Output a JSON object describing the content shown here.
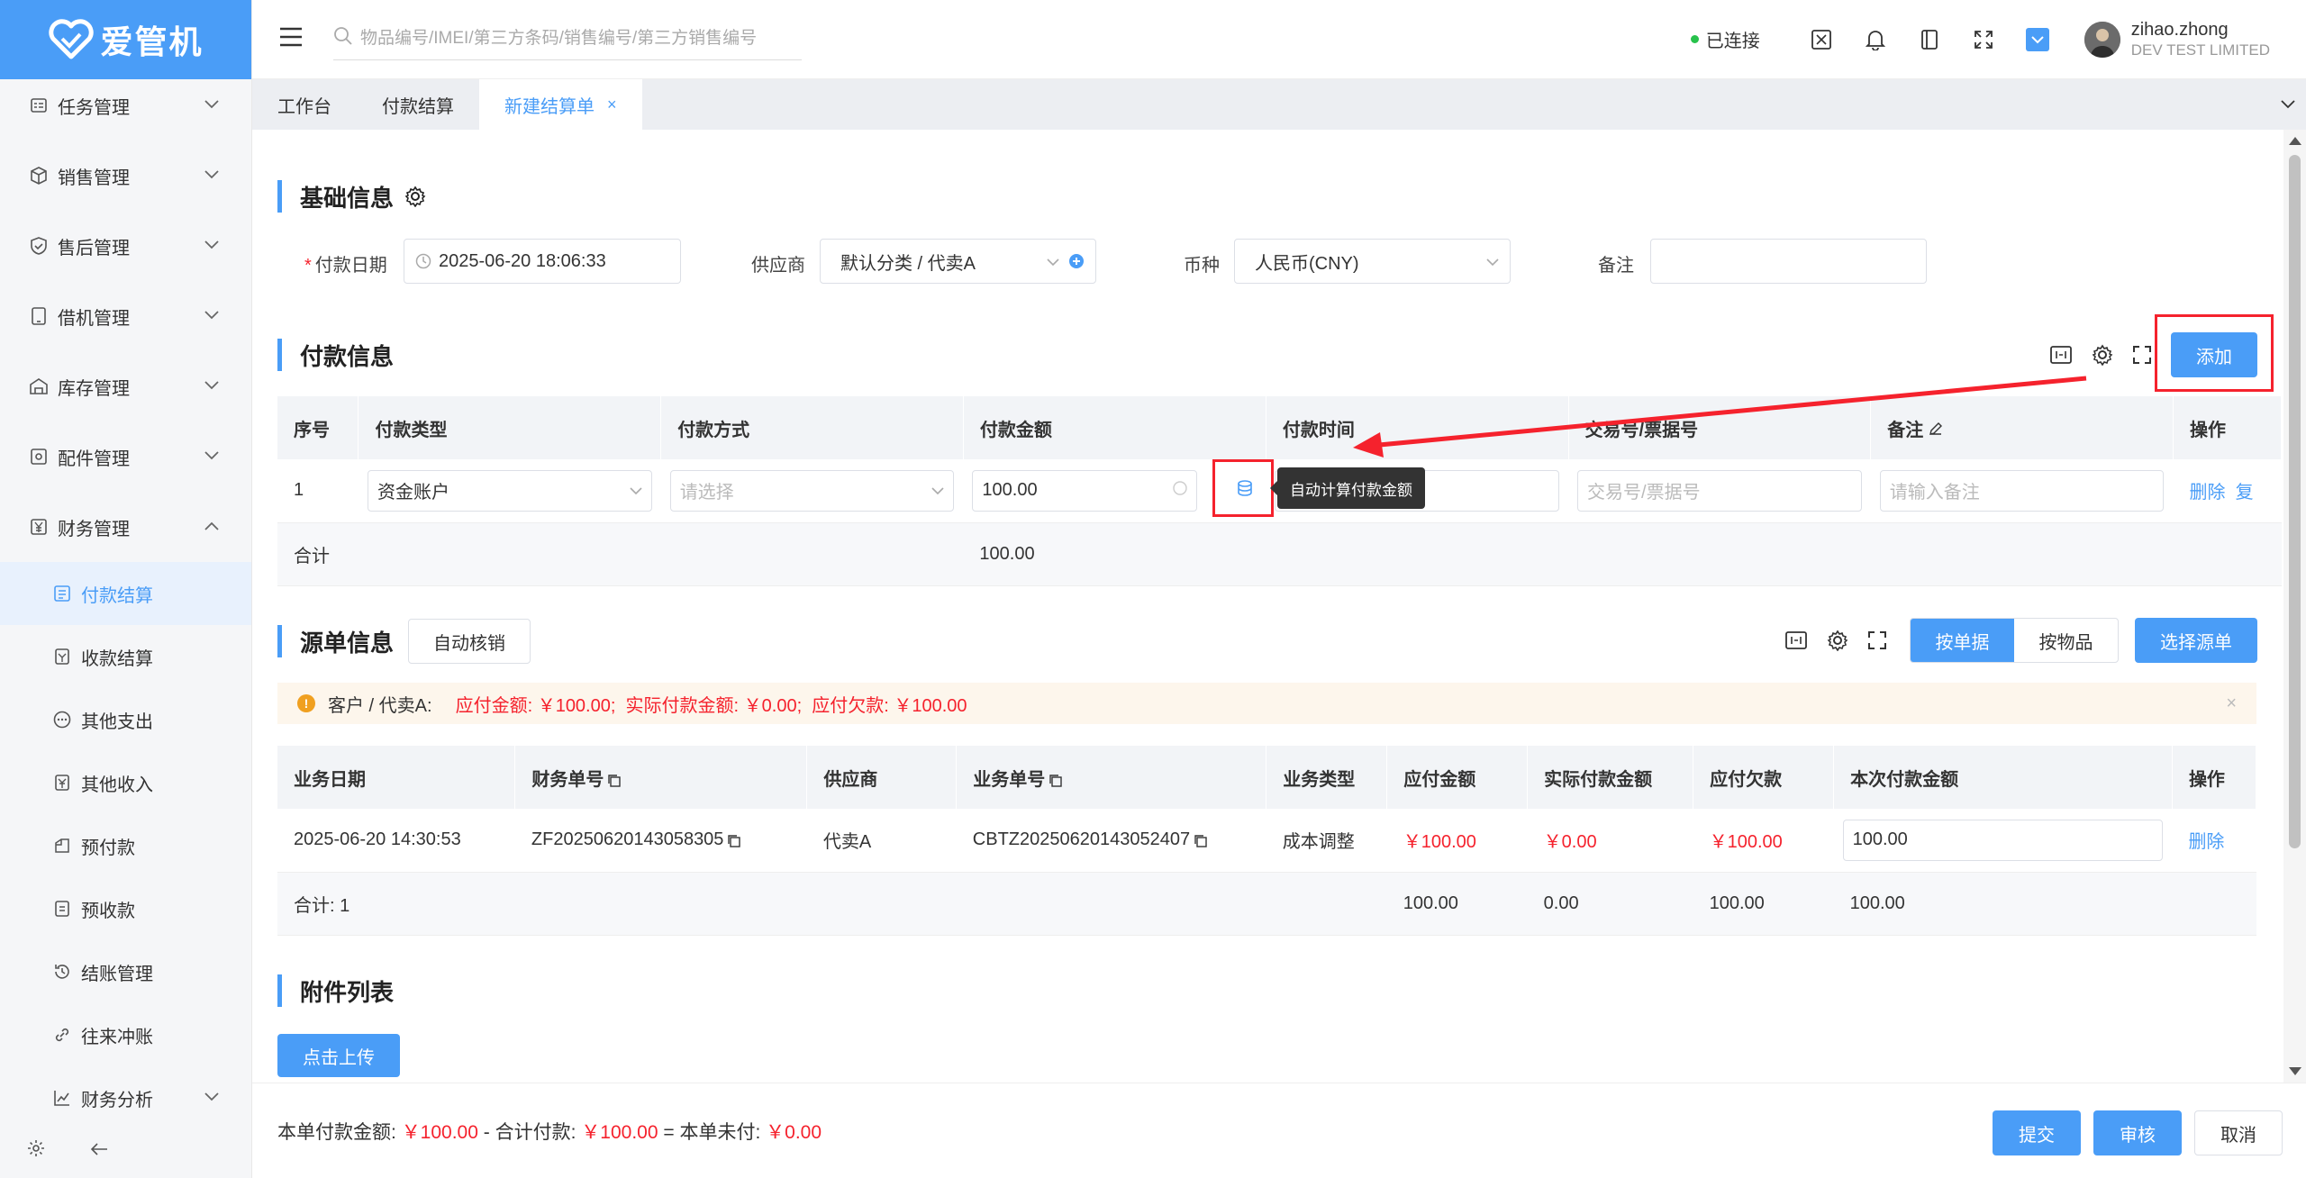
{
  "app": {
    "logo_text": "爱管机"
  },
  "sidebar": {
    "items": [
      {
        "label": "任务管理",
        "icon": "task-icon"
      },
      {
        "label": "销售管理",
        "icon": "box-icon"
      },
      {
        "label": "售后管理",
        "icon": "shield-icon"
      },
      {
        "label": "借机管理",
        "icon": "phone-icon"
      },
      {
        "label": "库存管理",
        "icon": "warehouse-icon"
      },
      {
        "label": "配件管理",
        "icon": "parts-icon"
      },
      {
        "label": "财务管理",
        "icon": "yen-icon"
      }
    ],
    "finance_sub": [
      {
        "label": "付款结算",
        "active": true
      },
      {
        "label": "收款结算"
      },
      {
        "label": "其他支出"
      },
      {
        "label": "其他收入"
      },
      {
        "label": "预付款"
      },
      {
        "label": "预收款"
      },
      {
        "label": "结账管理"
      },
      {
        "label": "往来冲账"
      }
    ],
    "analysis": {
      "label": "财务分析"
    }
  },
  "topbar": {
    "search_placeholder": "物品编号/IMEI/第三方条码/销售编号/第三方销售编号",
    "status": "已连接",
    "user_name": "zihao.zhong",
    "user_company": "DEV TEST LIMITED"
  },
  "tabs": [
    {
      "label": "工作台"
    },
    {
      "label": "付款结算"
    },
    {
      "label": "新建结算单",
      "active": true
    }
  ],
  "basic": {
    "title": "基础信息",
    "pay_date_label": "付款日期",
    "pay_date_value": "2025-06-20 18:06:33",
    "supplier_label": "供应商",
    "supplier_value": "默认分类 / 代卖A",
    "currency_label": "币种",
    "currency_value": "人民币(CNY)",
    "remark_label": "备注"
  },
  "payment": {
    "title": "付款信息",
    "add_button": "添加",
    "headers": [
      "序号",
      "付款类型",
      "付款方式",
      "付款金额",
      "付款时间",
      "交易号/票据号",
      "备注",
      "操作"
    ],
    "row": {
      "index": "1",
      "type": "资金账户",
      "method_placeholder": "请选择",
      "amount": "100.00",
      "trade_placeholder": "交易号/票据号",
      "remark_placeholder": "请输入备注",
      "delete": "删除",
      "copy": "复"
    },
    "tooltip": "自动计算付款金额",
    "sum_label": "合计",
    "sum_amount": "100.00"
  },
  "source": {
    "title": "源单信息",
    "auto_button": "自动核销",
    "seg_by_order": "按单据",
    "seg_by_item": "按物品",
    "select_button": "选择源单",
    "alert": {
      "customer": "客户 / 代卖A:",
      "text": "应付金额: ￥100.00;  实际付款金额: ￥0.00;  应付欠款: ￥100.00"
    },
    "headers": [
      "业务日期",
      "财务单号",
      "供应商",
      "业务单号",
      "业务类型",
      "应付金额",
      "实际付款金额",
      "应付欠款",
      "本次付款金额",
      "操作"
    ],
    "row": {
      "date": "2025-06-20 14:30:53",
      "fin_no": "ZF20250620143058305",
      "supplier": "代卖A",
      "biz_no": "CBTZ20250620143052407",
      "biz_type": "成本调整",
      "payable": "￥100.00",
      "paid": "￥0.00",
      "owed": "￥100.00",
      "this_pay": "100.00",
      "delete": "删除"
    },
    "sum": {
      "label": "合计: 1",
      "payable": "100.00",
      "paid": "0.00",
      "owed": "100.00",
      "this_pay": "100.00"
    }
  },
  "attachments": {
    "title": "附件列表",
    "upload_button": "点击上传"
  },
  "footer": {
    "label1": "本单付款金额:",
    "value1": "￥100.00",
    "label2": "- 合计付款:",
    "value2": "￥100.00",
    "label3": "= 本单未付:",
    "value3": "￥0.00",
    "submit": "提交",
    "audit": "审核",
    "cancel": "取消"
  },
  "colors": {
    "primary": "#4a9df7",
    "danger": "#f5222d",
    "warning_bg": "#fdf6ec"
  }
}
